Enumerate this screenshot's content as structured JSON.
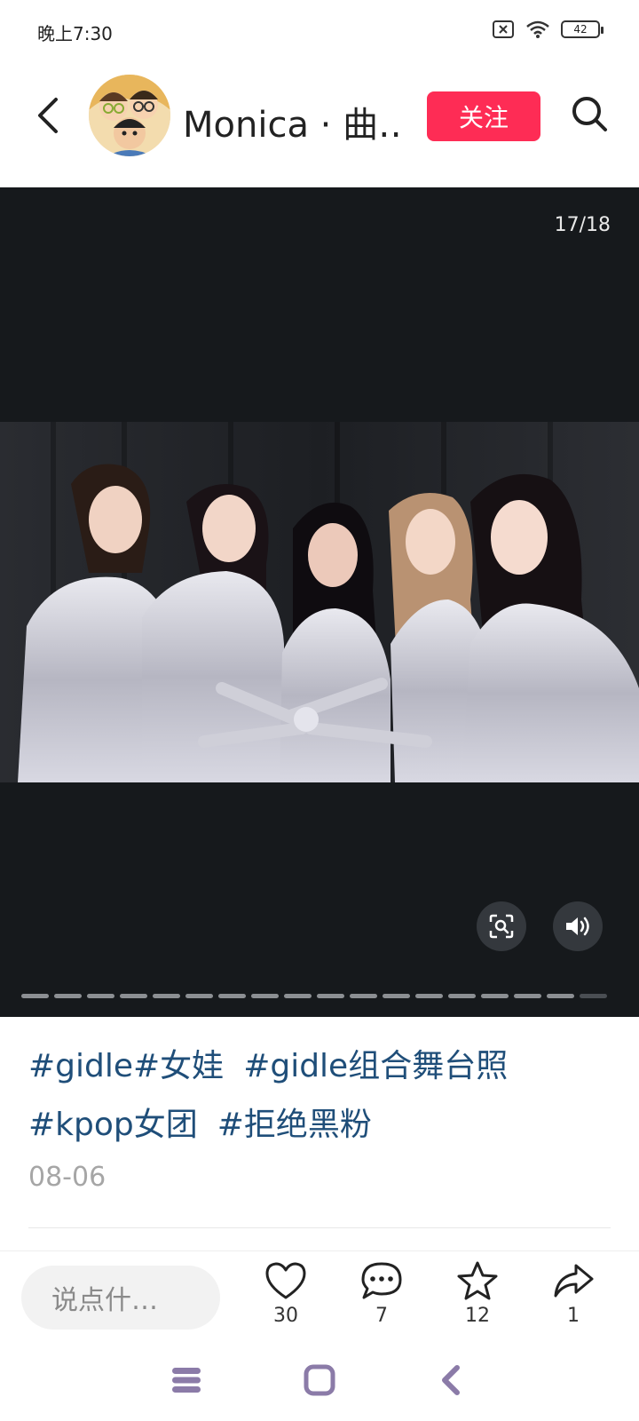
{
  "status": {
    "time": "晚上7:30",
    "battery": "42"
  },
  "header": {
    "username": "Monica · 曲…",
    "follow_label": "关注"
  },
  "media": {
    "page_counter": "17/18",
    "slide_count": 18,
    "current_slide": 17
  },
  "post": {
    "tags": [
      "#gidle#女娃",
      "#gidle组合舞台照",
      "#kpop女团",
      "#拒绝黑粉"
    ],
    "date": "08-06"
  },
  "bottom_bar": {
    "comment_placeholder": "说点什…",
    "like_count": "30",
    "comment_count": "7",
    "favorite_count": "12",
    "share_count": "1"
  },
  "colors": {
    "follow": "#fe2c55",
    "tag": "#1f4e79",
    "media_bg": "#16191c",
    "nav_icon": "#8b7ba8"
  },
  "icons": [
    "back-icon",
    "search-icon",
    "scan-icon",
    "volume-icon",
    "heart-icon",
    "comment-icon",
    "star-icon",
    "share-icon"
  ]
}
